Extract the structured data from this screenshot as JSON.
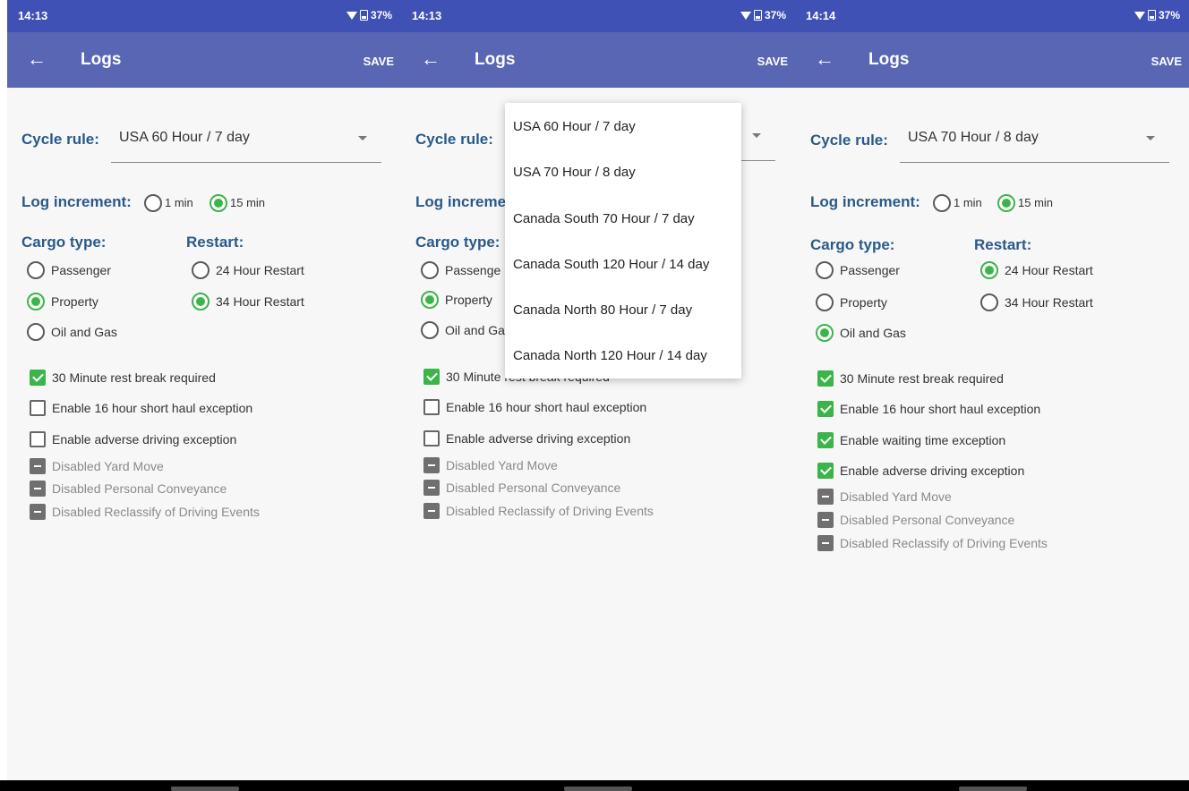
{
  "panels": [
    {
      "status": {
        "time": "14:13",
        "battery": "37%"
      },
      "appbar": {
        "title": "Logs",
        "save": "SAVE"
      },
      "cycle": {
        "label": "Cycle rule:",
        "value": "USA 60 Hour / 7 day"
      },
      "increment": {
        "label": "Log increment:",
        "opt1": "1 min",
        "opt2": "15 min",
        "selected": "15 min"
      },
      "cargo": {
        "label": "Cargo type:",
        "options": [
          "Passenger",
          "Property",
          "Oil and Gas"
        ],
        "selected": "Property"
      },
      "restart": {
        "label": "Restart:",
        "options": [
          "24 Hour Restart",
          "34 Hour Restart"
        ],
        "selected": "34 Hour Restart"
      },
      "checks": [
        {
          "label": "30 Minute rest break required",
          "checked": true
        },
        {
          "label": "Enable 16 hour short haul exception",
          "checked": false
        },
        {
          "label": "Enable adverse driving exception",
          "checked": false
        }
      ],
      "disabled": [
        "Disabled Yard Move",
        "Disabled Personal Conveyance",
        "Disabled Reclassify of Driving Events"
      ]
    },
    {
      "status": {
        "time": "14:13",
        "battery": "37%"
      },
      "appbar": {
        "title": "Logs",
        "save": "SAVE"
      },
      "cycle": {
        "label": "Cycle rule:"
      },
      "increment": {
        "label": "Log increme"
      },
      "cargo": {
        "label": "Cargo type:",
        "options": [
          "Passenge",
          "Property",
          "Oil and Ga"
        ],
        "selected": "Property"
      },
      "checks": [
        {
          "label": "30 Minute rest break required",
          "checked": true
        },
        {
          "label": "Enable 16 hour short haul exception",
          "checked": false
        },
        {
          "label": "Enable adverse driving exception",
          "checked": false
        }
      ],
      "disabled": [
        "Disabled Yard Move",
        "Disabled Personal Conveyance",
        "Disabled Reclassify of Driving Events"
      ]
    },
    {
      "status": {
        "time": "14:14",
        "battery": "37%"
      },
      "appbar": {
        "title": "Logs",
        "save": "SAVE"
      },
      "cycle": {
        "label": "Cycle rule:",
        "value": "USA 70 Hour / 8 day"
      },
      "increment": {
        "label": "Log increment:",
        "opt1": "1 min",
        "opt2": "15 min",
        "selected": "15 min"
      },
      "cargo": {
        "label": "Cargo type:",
        "options": [
          "Passenger",
          "Property",
          "Oil and Gas"
        ],
        "selected": "Oil and Gas"
      },
      "restart": {
        "label": "Restart:",
        "options": [
          "24 Hour Restart",
          "34 Hour Restart"
        ],
        "selected": "24 Hour Restart"
      },
      "checks": [
        {
          "label": "30 Minute rest break required",
          "checked": true
        },
        {
          "label": "Enable 16 hour short haul exception",
          "checked": true
        },
        {
          "label": "Enable waiting time exception",
          "checked": true
        },
        {
          "label": "Enable adverse driving exception",
          "checked": true
        }
      ],
      "disabled": [
        "Disabled Yard Move",
        "Disabled Personal Conveyance",
        "Disabled Reclassify of Driving Events"
      ]
    }
  ],
  "dropdown": {
    "options": [
      "USA 60 Hour / 7 day",
      "USA 70 Hour / 8 day",
      "Canada South 70 Hour / 7 day",
      "Canada South 120 Hour / 14 day",
      "Canada North 80 Hour / 7 day",
      "Canada North 120 Hour / 14 day"
    ]
  },
  "colors": {
    "status_bar": "#3f51b5",
    "app_bar": "#5966b4",
    "label": "#2a5a8a",
    "accent_green": "#3bb54a"
  }
}
